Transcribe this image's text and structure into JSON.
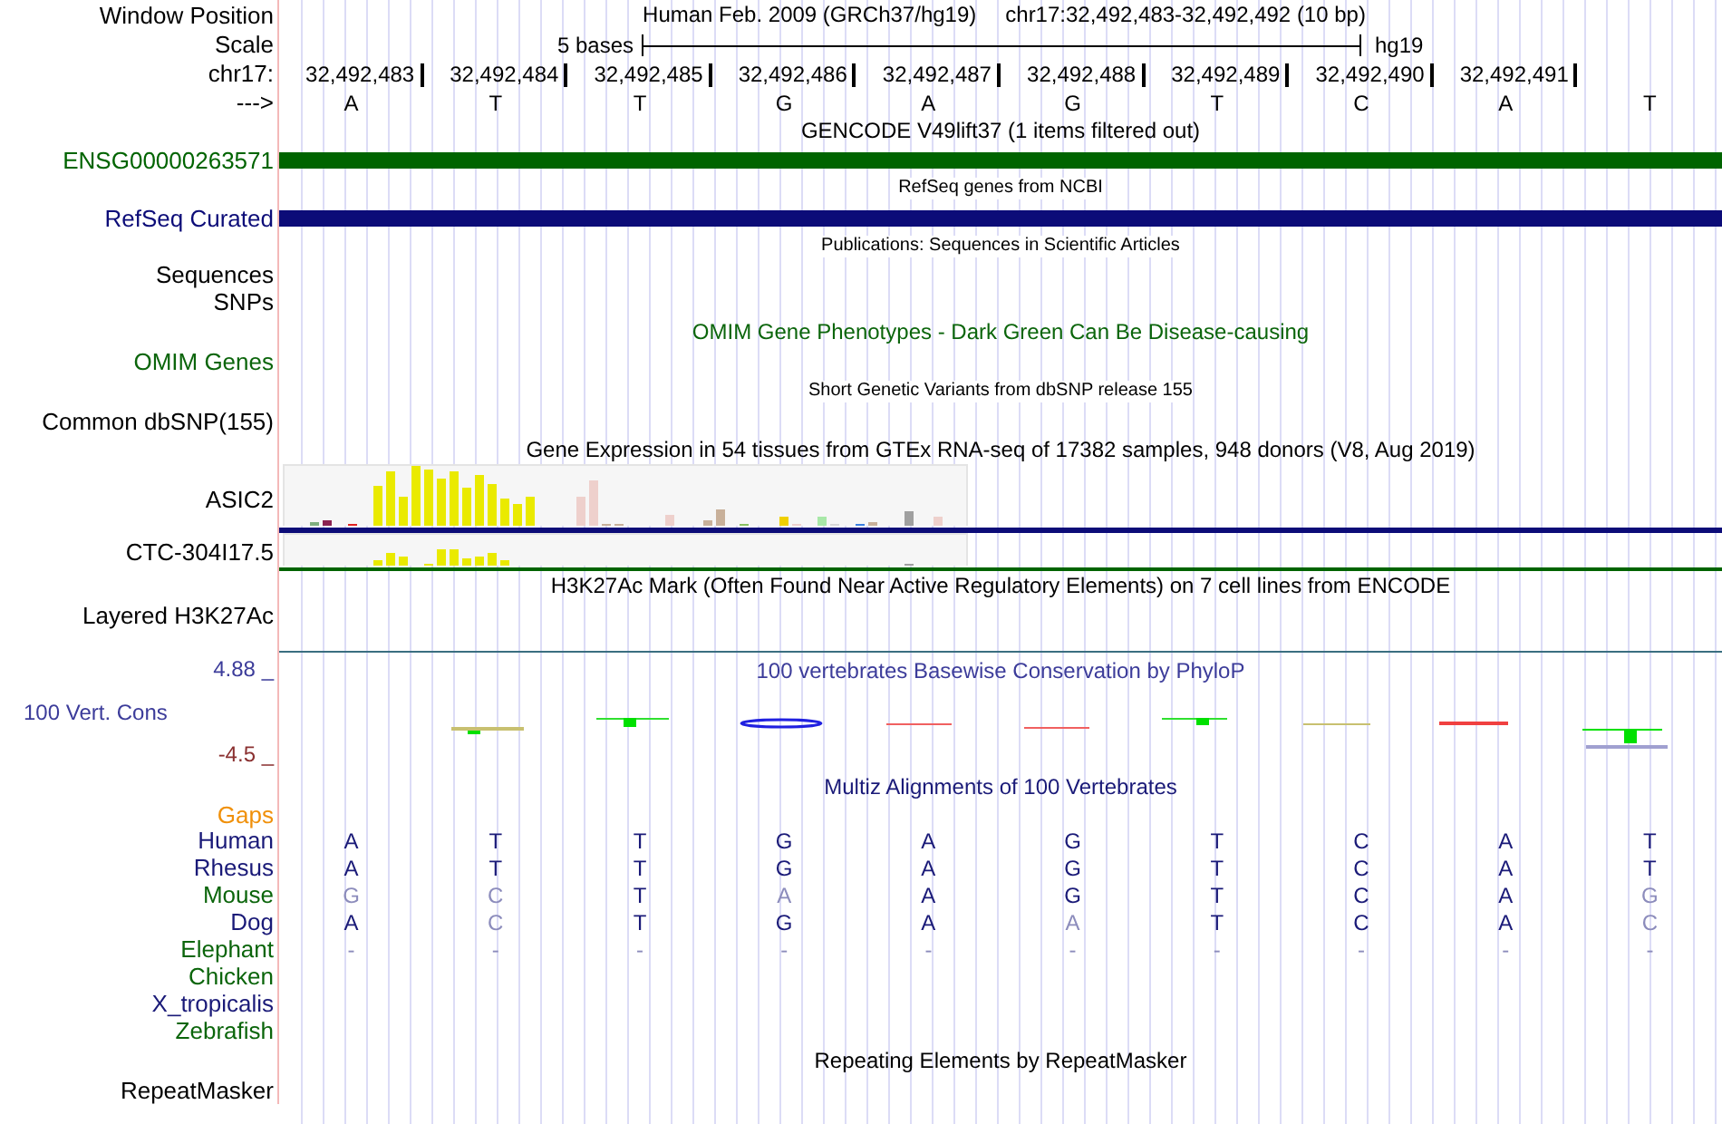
{
  "header": {
    "label": "Window Position",
    "assembly": "Human Feb. 2009 (GRCh37/hg19)",
    "position": "chr17:32,492,483-32,492,492 (10 bp)"
  },
  "scale": {
    "label": "Scale",
    "size": "5 bases",
    "assembly": "hg19"
  },
  "ruler": {
    "label": "chr17:",
    "positions": [
      "32,492,483",
      "32,492,484",
      "32,492,485",
      "32,492,486",
      "32,492,487",
      "32,492,488",
      "32,492,489",
      "32,492,490",
      "32,492,491"
    ]
  },
  "bases": {
    "label": "--->",
    "sequence": [
      "A",
      "T",
      "T",
      "G",
      "A",
      "G",
      "T",
      "C",
      "A",
      "T"
    ]
  },
  "tracks": [
    {
      "kind": "gene",
      "title": "GENCODE V49lift37 (1 items filtered out)",
      "label": "ENSG00000263571",
      "color": "#006400"
    },
    {
      "kind": "gene",
      "title": "RefSeq genes from NCBI",
      "label": "RefSeq Curated",
      "color": "#0c0c78"
    },
    {
      "kind": "list",
      "title": "Publications: Sequences in Scientific Articles",
      "labels": [
        "Sequences",
        "SNPs"
      ]
    },
    {
      "kind": "plain",
      "title": "OMIM Gene Phenotypes - Dark Green Can Be Disease-causing",
      "label": "OMIM Genes",
      "color": "#0b650b"
    },
    {
      "kind": "plain",
      "title": "Short Genetic Variants from dbSNP release 155",
      "label": "Common dbSNP(155)",
      "color": "#000000"
    },
    {
      "kind": "expression",
      "title": "Gene Expression in 54 tissues from GTEx RNA-seq of 17382 samples, 948 donors (V8, Aug 2019)",
      "genes": [
        {
          "label": "ASIC2",
          "color": "#0c0c78"
        },
        {
          "label": "CTC-304I17.5",
          "color": "#006400"
        }
      ]
    },
    {
      "kind": "layered",
      "title": "H3K27Ac Mark (Often Found Near Active Regulatory Elements) on 7 cell lines from ENCODE",
      "label": "Layered H3K27Ac"
    },
    {
      "kind": "conservation",
      "title": "100 vertebrates Basewise Conservation by PhyloP",
      "label": "100 Vert. Cons",
      "max": "4.88 _",
      "min": "-4.5 _"
    },
    {
      "kind": "alignment",
      "title": "Multiz Alignments of 100 Vertebrates",
      "gaps": "Gaps",
      "species": [
        {
          "name": "Human",
          "color": "#1a1a78",
          "bases": [
            "A",
            "T",
            "T",
            "G",
            "A",
            "G",
            "T",
            "C",
            "A",
            "T"
          ]
        },
        {
          "name": "Rhesus",
          "color": "#1a1a78",
          "bases": [
            "A",
            "T",
            "T",
            "G",
            "A",
            "G",
            "T",
            "C",
            "A",
            "T"
          ]
        },
        {
          "name": "Mouse",
          "color": "#0b650b",
          "bases": [
            "G",
            "C",
            "T",
            "A",
            "A",
            "G",
            "T",
            "C",
            "A",
            "G"
          ]
        },
        {
          "name": "Dog",
          "color": "#1a1a78",
          "bases": [
            "A",
            "C",
            "T",
            "G",
            "A",
            "A",
            "T",
            "C",
            "A",
            "C"
          ]
        },
        {
          "name": "Elephant",
          "color": "#0b650b",
          "bases": [
            "-",
            "-",
            "-",
            "-",
            "-",
            "-",
            "-",
            "-",
            "-",
            "-"
          ]
        },
        {
          "name": "Chicken",
          "color": "#0b650b"
        },
        {
          "name": "X_tropicalis",
          "color": "#1a1a78"
        },
        {
          "name": "Zebrafish",
          "color": "#0b650b"
        }
      ]
    },
    {
      "kind": "plain",
      "title": "Repeating Elements by RepeatMasker",
      "label": "RepeatMasker",
      "color": "#000000"
    }
  ]
}
